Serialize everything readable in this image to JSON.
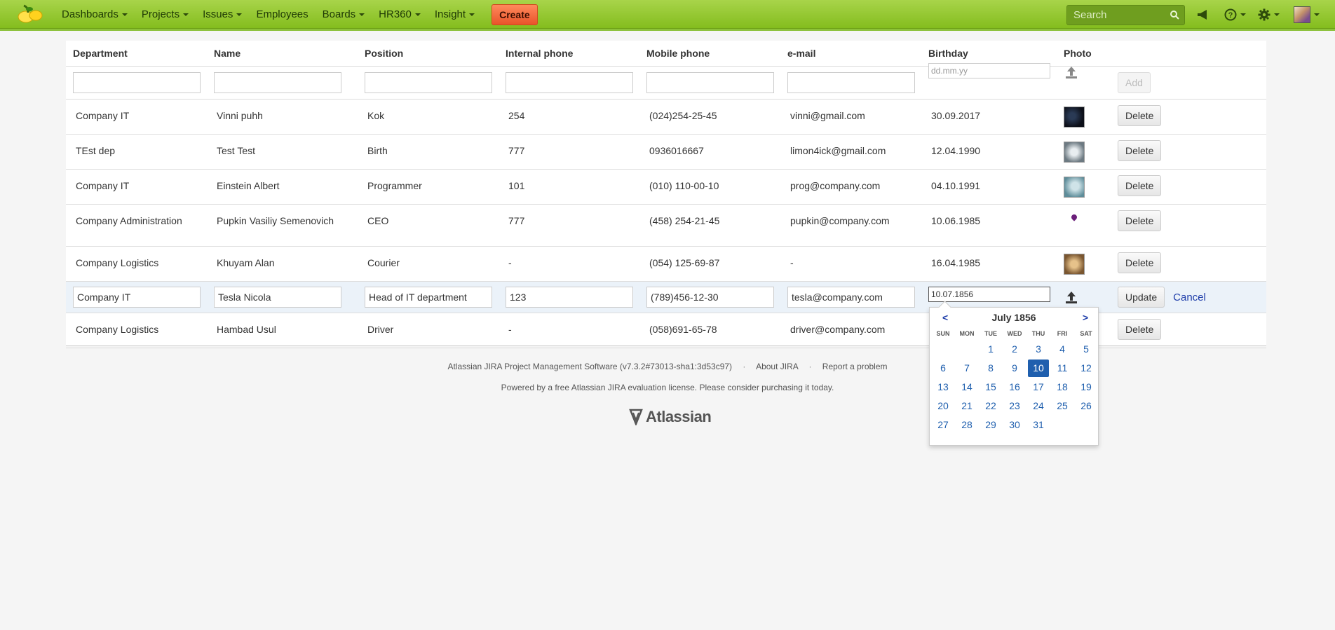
{
  "nav": {
    "items": [
      {
        "label": "Dashboards",
        "dropdown": true
      },
      {
        "label": "Projects",
        "dropdown": true
      },
      {
        "label": "Issues",
        "dropdown": true
      },
      {
        "label": "Employees",
        "dropdown": false
      },
      {
        "label": "Boards",
        "dropdown": true
      },
      {
        "label": "HR360",
        "dropdown": true
      },
      {
        "label": "Insight",
        "dropdown": true
      }
    ],
    "create_label": "Create",
    "search_placeholder": "Search",
    "icons": [
      "megaphone-icon",
      "help-icon",
      "gear-icon",
      "avatar"
    ]
  },
  "table": {
    "headers": [
      "Department",
      "Name",
      "Position",
      "Internal phone",
      "Mobile phone",
      "e-mail",
      "Birthday",
      "Photo"
    ],
    "filter": {
      "birthday_placeholder": "dd.mm.yy",
      "add_label": "Add"
    },
    "rows_before_edit": [
      {
        "department": "Company IT",
        "name": "Vinni puhh",
        "position": "Kok",
        "internal": "254",
        "mobile": "(024)254-25-45",
        "email": "vinni@gmail.com",
        "birthday": "30.09.2017",
        "delete_label": "Delete"
      },
      {
        "department": "TEst dep",
        "name": "Test Test",
        "position": "Birth",
        "internal": "777",
        "mobile": "0936016667",
        "email": "limon4ick@gmail.com",
        "birthday": "12.04.1990",
        "delete_label": "Delete"
      },
      {
        "department": "Company IT",
        "name": "Einstein Albert",
        "position": "Programmer",
        "internal": "101",
        "mobile": "(010) 110-00-10",
        "email": "prog@company.com",
        "birthday": "04.10.1991",
        "delete_label": "Delete"
      },
      {
        "department": "Company Administration",
        "name": "Pupkin Vasiliy Semenovich",
        "position": "CEO",
        "internal": "777",
        "mobile": "(458) 254-21-45",
        "email": "pupkin@company.com",
        "birthday": "10.06.1985",
        "delete_label": "Delete"
      },
      {
        "department": "Company Logistics",
        "name": "Khuyam Alan",
        "position": "Courier",
        "internal": "-",
        "mobile": "(054) 125-69-87",
        "email": "-",
        "birthday": "16.04.1985",
        "delete_label": "Delete"
      }
    ],
    "edit_row": {
      "department": "Company IT",
      "name": "Tesla Nicola",
      "position": "Head of IT department",
      "internal": "123",
      "mobile": "(789)456-12-30",
      "email": "tesla@company.com",
      "birthday": "10.07.1856",
      "update_label": "Update",
      "cancel_label": "Cancel"
    },
    "rows_after_edit": [
      {
        "department": "Company Logistics",
        "name": "Hambad Usul",
        "position": "Driver",
        "internal": "-",
        "mobile": "(058)691-65-78",
        "email": "driver@company.com",
        "birthday": "",
        "delete_label": "Delete"
      }
    ]
  },
  "datepicker": {
    "month_label": "July 1856",
    "prev": "<",
    "next": ">",
    "weekdays": [
      "SUN",
      "MON",
      "TUE",
      "WED",
      "THU",
      "FRI",
      "SAT"
    ],
    "first_weekday_index": 2,
    "days_in_month": 31,
    "selected_day": 10
  },
  "footer": {
    "line1": "Atlassian JIRA Project Management Software (v7.3.2#73013-sha1:3d53c97)",
    "about": "About JIRA",
    "report": "Report a problem",
    "line2": "Powered by a free Atlassian JIRA evaluation license. Please consider purchasing it today.",
    "logo_text": "Atlassian"
  },
  "colors": {
    "header": "#8cc13a",
    "create": "#f0703f",
    "link": "#1f3eaa",
    "selected_day": "#1f5fae"
  }
}
